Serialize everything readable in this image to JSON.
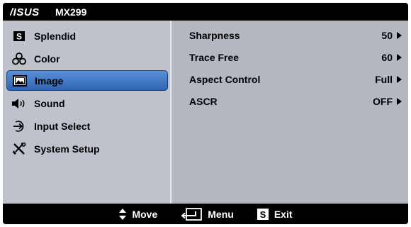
{
  "header": {
    "brand": "/ISUS",
    "model": "MX299"
  },
  "sidebar": {
    "items": [
      {
        "label": "Splendid",
        "icon": "splendid-s-icon"
      },
      {
        "label": "Color",
        "icon": "color-circles-icon"
      },
      {
        "label": "Image",
        "icon": "image-picture-icon",
        "active": true
      },
      {
        "label": "Sound",
        "icon": "speaker-icon"
      },
      {
        "label": "Input Select",
        "icon": "input-arrow-icon"
      },
      {
        "label": "System Setup",
        "icon": "tools-icon"
      }
    ]
  },
  "panel": {
    "settings": [
      {
        "label": "Sharpness",
        "value": "50"
      },
      {
        "label": "Trace Free",
        "value": "60"
      },
      {
        "label": "Aspect Control",
        "value": "Full"
      },
      {
        "label": "ASCR",
        "value": "OFF"
      }
    ]
  },
  "footer": {
    "move_label": "Move",
    "menu_label": "Menu",
    "exit_label": "Exit"
  },
  "colors": {
    "active_item": "#3f77c6",
    "panel_bg": "#b3b7bf",
    "bar_bg": "#000000"
  }
}
